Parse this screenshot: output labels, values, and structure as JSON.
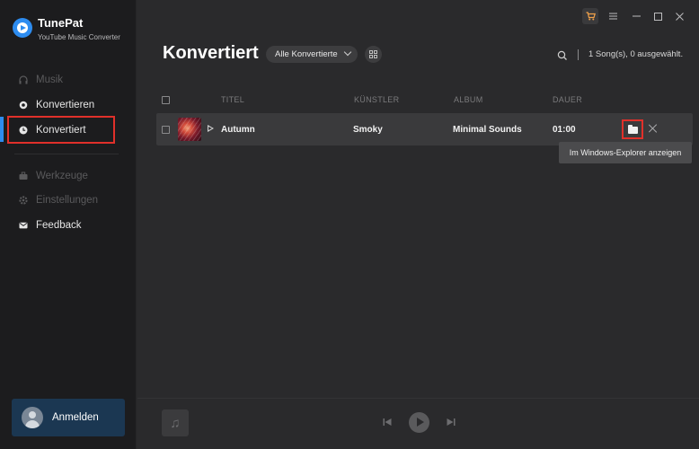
{
  "app": {
    "name": "TunePat",
    "subtitle": "YouTube Music Converter"
  },
  "sidebar": {
    "items": [
      {
        "label": "Musik",
        "icon": "headphones-icon",
        "enabled": false
      },
      {
        "label": "Konvertieren",
        "icon": "convert-icon",
        "enabled": true
      },
      {
        "label": "Konvertiert",
        "icon": "clock-icon",
        "enabled": true,
        "active": true
      },
      {
        "label": "Werkzeuge",
        "icon": "toolbox-icon",
        "enabled": false
      },
      {
        "label": "Einstellungen",
        "icon": "gear-icon",
        "enabled": false
      },
      {
        "label": "Feedback",
        "icon": "mail-icon",
        "enabled": true
      }
    ],
    "login_label": "Anmelden"
  },
  "header": {
    "title": "Konvertiert",
    "filter_label": "Alle Konvertierte",
    "status": "1 Song(s), 0 ausgewählt."
  },
  "table": {
    "columns": [
      "TITEL",
      "KÜNSTLER",
      "ALBUM",
      "DAUER"
    ],
    "rows": [
      {
        "title": "Autumn",
        "artist": "Smoky",
        "album": "Minimal Sounds",
        "duration": "01:00"
      }
    ]
  },
  "tooltip": "Im Windows-Explorer anzeigen",
  "colors": {
    "accent": "#2d8cf0",
    "highlight": "#e0302a",
    "cart": "#f2a24a"
  }
}
